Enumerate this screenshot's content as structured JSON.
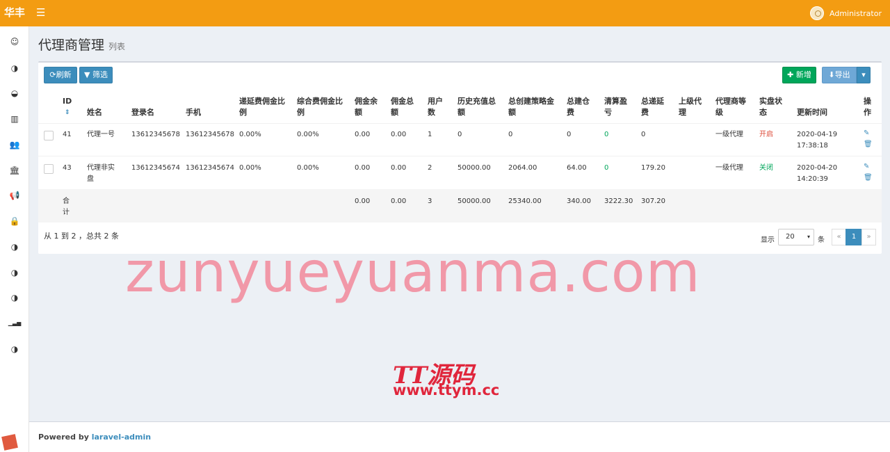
{
  "topbar": {
    "logo": "华丰",
    "menu_icon": "☰",
    "user_name": "Administrator"
  },
  "sidebar": {
    "items": [
      {
        "icon": "avatar-icon",
        "glyph": "☺"
      },
      {
        "icon": "circle-half-icon",
        "glyph": "◑"
      },
      {
        "icon": "circle-half-icon",
        "glyph": "◒"
      },
      {
        "icon": "bar-chart-icon",
        "glyph": "▥"
      },
      {
        "icon": "users-icon",
        "glyph": "👥"
      },
      {
        "icon": "bank-icon",
        "glyph": "🏛"
      },
      {
        "icon": "bullhorn-icon",
        "glyph": "📢"
      },
      {
        "icon": "lock-icon",
        "glyph": "🔒"
      },
      {
        "icon": "circle-half-icon",
        "glyph": "◑"
      },
      {
        "icon": "circle-half-icon",
        "glyph": "◑"
      },
      {
        "icon": "circle-half-icon",
        "glyph": "◑"
      },
      {
        "icon": "signal-icon",
        "glyph": "▁▃▅"
      },
      {
        "icon": "circle-half-icon",
        "glyph": "◑"
      }
    ]
  },
  "page": {
    "title": "代理商管理",
    "subtitle": "列表"
  },
  "toolbar": {
    "refresh": "⟳刷新",
    "filter": "▼ 筛选",
    "new": "✚ 新增",
    "export": "⬇导出",
    "caret": "▾"
  },
  "table": {
    "headers": {
      "id": "ID",
      "sort": "⇕",
      "name": "姓名",
      "login": "登录名",
      "phone": "手机",
      "delay_ratio_1": "递延费佣金比",
      "delay_ratio_2": "例",
      "comp_ratio_1": "综合费佣金比",
      "comp_ratio_2": "例",
      "bal_1": "佣金余",
      "bal_2": "额",
      "total_1": "佣金总",
      "total_2": "额",
      "users_1": "用户",
      "users_2": "数",
      "recharge_1": "历史充值总",
      "recharge_2": "额",
      "strategy_1": "总创建策略金",
      "strategy_2": "额",
      "open_1": "总建仓",
      "open_2": "费",
      "settle_1": "清算盈",
      "settle_2": "亏",
      "deferred_1": "总递延",
      "deferred_2": "费",
      "parent_1": "上级代",
      "parent_2": "理",
      "level_1": "代理商等",
      "level_2": "级",
      "real_1": "实盘状",
      "real_2": "态",
      "updated": "更新时间",
      "ops_1": "操",
      "ops_2": "作"
    },
    "rows": [
      {
        "id": "41",
        "name_1": "代理一号",
        "name_2": "",
        "login": "13612345678",
        "phone": "13612345678",
        "delay_ratio": "0.00%",
        "comp_ratio": "0.00%",
        "bal": "0.00",
        "total": "0.00",
        "users": "1",
        "recharge": "0",
        "strategy": "0",
        "open": "0",
        "settle": "0",
        "deferred": "0",
        "parent": "",
        "level": "一级代理",
        "real": "开启",
        "date": "2020-04-19",
        "time": "17:38:18"
      },
      {
        "id": "43",
        "name_1": "代理非实",
        "name_2": "盘",
        "login": "13612345674",
        "phone": "13612345674",
        "delay_ratio": "0.00%",
        "comp_ratio": "0.00%",
        "bal": "0.00",
        "total": "0.00",
        "users": "2",
        "recharge": "50000.00",
        "strategy": "2064.00",
        "open": "64.00",
        "settle": "0",
        "deferred": "179.20",
        "parent": "",
        "level": "一级代理",
        "real": "关闭",
        "date": "2020-04-20",
        "time": "14:20:39"
      }
    ],
    "summary": {
      "label_1": "合",
      "label_2": "计",
      "bal": "0.00",
      "total": "0.00",
      "users": "3",
      "recharge": "50000.00",
      "strategy": "25340.00",
      "open": "340.00",
      "settle": "3222.30",
      "deferred": "307.20"
    },
    "edit_glyph": "✎",
    "delete_glyph": "🗑"
  },
  "pagination": {
    "info": "从 1 到 2 ，总共 2 条",
    "show": "显示",
    "per_page": "20",
    "per_page_arrow": "▾",
    "unit": "条",
    "prev": "«",
    "current": "1",
    "next": "»"
  },
  "watermark": "zunyueyuanma.com",
  "tt_logo": "TT源码",
  "tt_url": "www.ttym.cc",
  "footer": {
    "powered": "Powered by ",
    "link": "laravel-admin"
  },
  "colors": {
    "topbar": "#f39c12",
    "primary": "#3c8dbc",
    "success": "#00a65a",
    "danger": "#dd4b39"
  }
}
